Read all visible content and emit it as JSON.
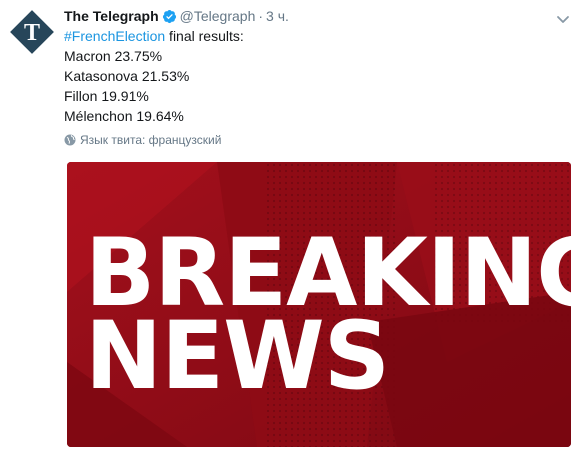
{
  "tweet": {
    "name": "The Telegraph",
    "handle": "@Telegraph",
    "separator": "·",
    "time": "3 ч.",
    "hashtag": "#FrenchElection",
    "intro_rest": " final results:",
    "results": [
      "Macron 23.75%",
      "Katasonova 21.53%",
      "Fillon 19.91%",
      "Mélenchon 19.64%"
    ],
    "translate_label": "Язык твита: французский",
    "icons": {
      "avatar": "telegraph-logo",
      "verified": "verified-badge-icon",
      "menu": "chevron-down-icon",
      "globe": "globe-icon"
    }
  },
  "media": {
    "line1": "BREAKING",
    "line2": "NEWS"
  },
  "colors": {
    "link": "#1b95e0",
    "muted": "#657786",
    "verified": "#1da1f2",
    "media_bg": "#8b0a14",
    "avatar_bg": "#27465a"
  }
}
